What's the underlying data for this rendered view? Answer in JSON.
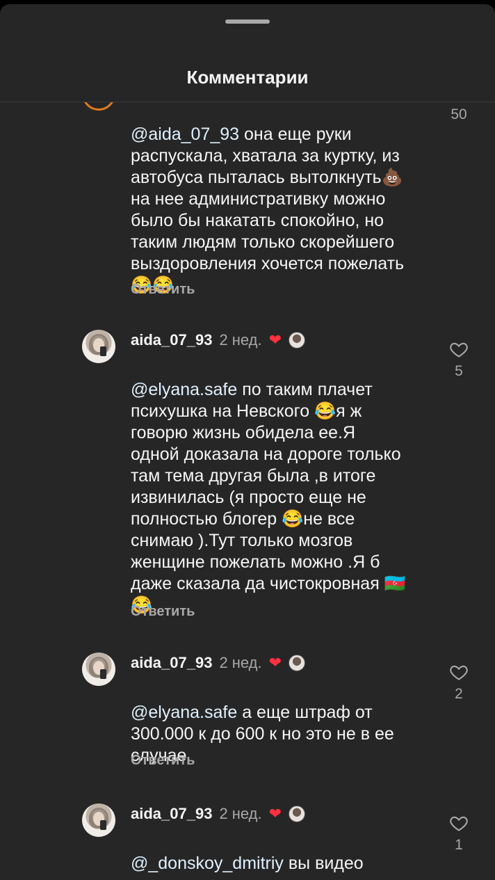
{
  "header": {
    "title": "Комментарии"
  },
  "comments": [
    {
      "mention": "@aida_07_93",
      "text": " она еще руки\nраспускала, хватала за куртку, из\nавтобуса пыталась вытолкнуть💩\nна нее административку можно\nбыло бы накатать спокойно, но\nтаким людям только скорейшего\nвыздоровления хочется пожелать\n😂😂",
      "likes": "50",
      "reply": "Ответить"
    },
    {
      "username": "aida_07_93",
      "time": "2 нед.",
      "mention": "@elyana.safe",
      "text": " по таким плачет\nпсихушка на Невского 😂я ж\nговорю жизнь обидела ее.Я\nодной доказала на дороге только\nтам тема другая была ,в итоге\nизвинилась (я просто еще не\nполностью блогер 😂не  все\nснимаю ).Тут только мозгов\nженщине пожелать можно .Я б\nдаже сказала да чистокровная 🇦🇿\n😂",
      "likes": "5",
      "reply": "Ответить"
    },
    {
      "username": "aida_07_93",
      "time": "2 нед.",
      "mention": "@elyana.safe",
      "text": " а еще штраф от\n300.000 к до 600 к но это не в ее\nслучае",
      "likes": "2",
      "reply": "Ответить"
    },
    {
      "username": "aida_07_93",
      "time": "2 нед.",
      "mention": "@_donskoy_dmitriy",
      "text": " вы видео\nвзгляните и тут девушка не\nчанистка такие же и чанисты",
      "likes": "1"
    }
  ],
  "icons": {
    "like": "heart-outline-icon",
    "creator_like": "heart-filled-icon"
  },
  "colors": {
    "background": "#262626",
    "text": "#f5f5f5",
    "secondary": "#a8a8a8",
    "heart": "#ff3040"
  }
}
